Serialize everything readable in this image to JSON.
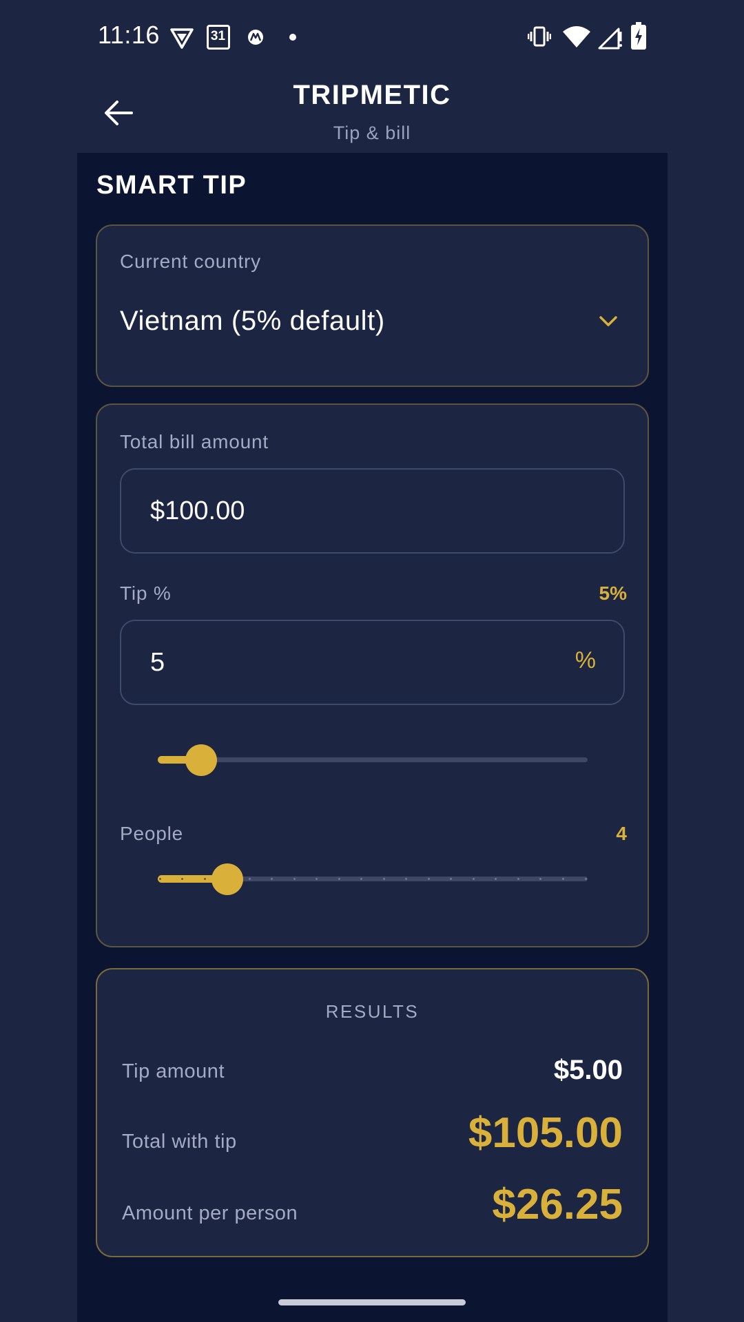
{
  "status_bar": {
    "time": "11:16",
    "calendar_day": "31",
    "icons": [
      "vpn-shield-icon",
      "calendar-icon",
      "motorola-icon",
      "notification-dot-icon",
      "vibrate-icon",
      "wifi-icon",
      "signal-icon",
      "battery-charging-icon"
    ]
  },
  "app_bar": {
    "title": "TRIPMETIC",
    "subtitle": "Tip & bill",
    "back_icon": "back-arrow-icon"
  },
  "section": {
    "title": "SMART TIP"
  },
  "country": {
    "label": "Current country",
    "selected": "Vietnam (5% default)",
    "icon": "chevron-down-icon"
  },
  "bill": {
    "label": "Total bill amount",
    "value": "$100.00"
  },
  "tip": {
    "label": "Tip %",
    "badge": "5%",
    "value": "5",
    "suffix": "%",
    "slider_fraction": 0.05
  },
  "people": {
    "label": "People",
    "value": "4",
    "min": 1,
    "max": 20,
    "current": 4
  },
  "results": {
    "title": "RESULTS",
    "tip_amount_label": "Tip amount",
    "tip_amount_value": "$5.00",
    "total_label": "Total with tip",
    "total_value": "$105.00",
    "per_person_label": "Amount per person",
    "per_person_value": "$26.25"
  },
  "colors": {
    "background": "#1c2542",
    "panel": "#0b1430",
    "accent_gold": "#d9b13a",
    "muted_text": "#a3acc4",
    "card_border": "#5d5540"
  }
}
